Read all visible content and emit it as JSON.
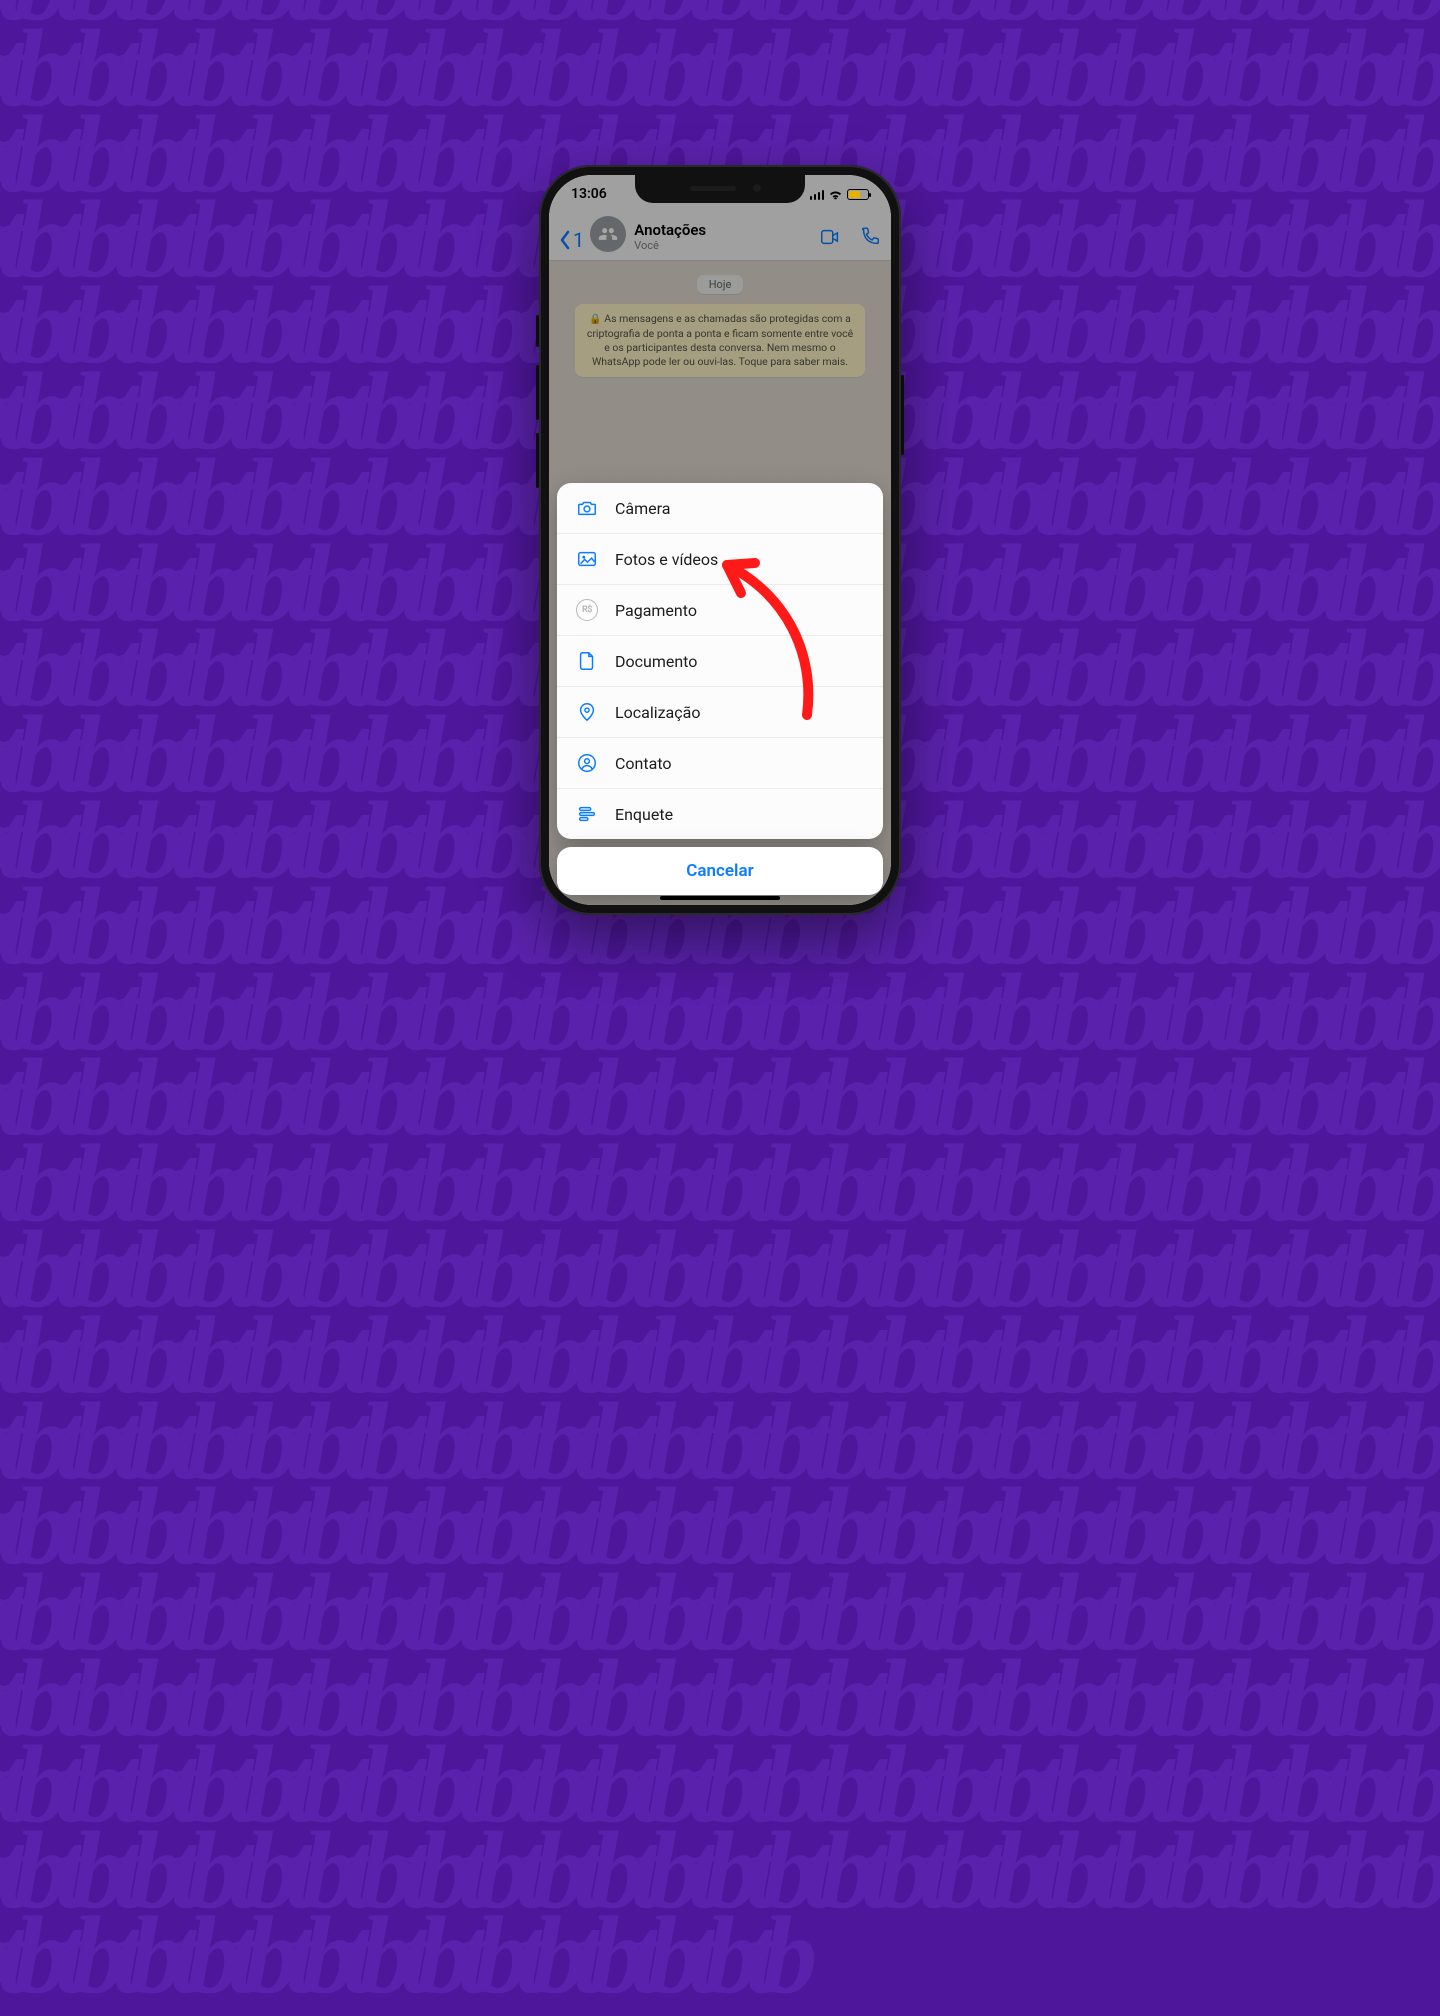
{
  "status": {
    "time": "13:06"
  },
  "header": {
    "back_count": "1",
    "chat_name": "Anotações",
    "chat_subtitle": "Você"
  },
  "chat": {
    "date_pill": "Hoje",
    "encryption_notice": "As mensagens e as chamadas são protegidas com a criptografia de ponta a ponta e ficam somente entre você e os participantes desta conversa. Nem mesmo o WhatsApp pode ler ou ouvi-las. Toque para saber mais."
  },
  "sheet": {
    "items": [
      {
        "label": "Câmera"
      },
      {
        "label": "Fotos e vídeos"
      },
      {
        "label": "Pagamento"
      },
      {
        "label": "Documento"
      },
      {
        "label": "Localização"
      },
      {
        "label": "Contato"
      },
      {
        "label": "Enquete"
      }
    ],
    "cancel": "Cancelar",
    "payment_badge": "R$"
  }
}
